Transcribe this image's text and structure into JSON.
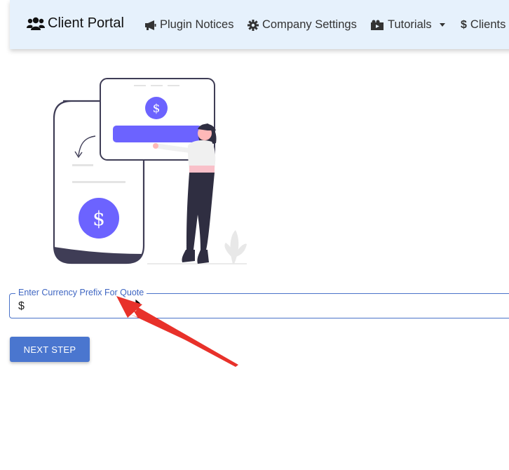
{
  "navbar": {
    "brand": {
      "icon": "users-icon",
      "label": "Client Portal"
    },
    "items": [
      {
        "icon": "megaphone-icon",
        "label": "Plugin Notices"
      },
      {
        "icon": "gear-icon",
        "label": "Company Settings"
      },
      {
        "icon": "photo-video-icon",
        "label": "Tutorials",
        "dropdown": true
      },
      {
        "icon": "dollar-icon",
        "label": "Clients"
      }
    ]
  },
  "illustration": {
    "screen_symbol": "$",
    "phone_symbol": "$",
    "accent_color": "#6c63ff"
  },
  "form": {
    "currency_prefix": {
      "label": "Enter Currency Prefix For Quote",
      "value": "$"
    },
    "next_button": "NEXT STEP"
  },
  "colors": {
    "navbar_bg": "#e6f1fc",
    "primary": "#4a76cf",
    "annotation_arrow": "#e8312a"
  }
}
